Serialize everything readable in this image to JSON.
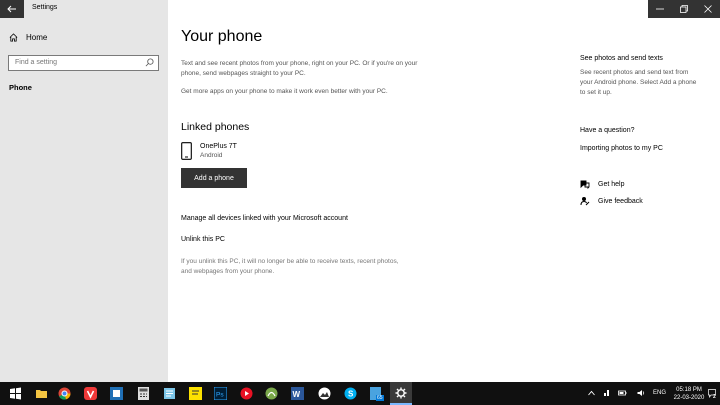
{
  "app": {
    "title": "Settings"
  },
  "nav": {
    "home_label": "Home",
    "search_placeholder": "Find a setting",
    "current_label": "Phone"
  },
  "main": {
    "title": "Your phone",
    "description": "Text and see recent photos from your phone, right on your PC. Or if you're on your phone, send webpages straight to your PC.",
    "more_apps": "Get more apps on your phone to make it work even better with your PC.",
    "linked_title": "Linked phones",
    "device": {
      "name": "OnePlus 7T",
      "os": "Android"
    },
    "add_button": "Add a phone",
    "manage_link": "Manage all devices linked with your Microsoft account",
    "unlink_link": "Unlink this PC",
    "unlink_desc": "If you unlink this PC, it will no longer be able to receive texts, recent photos, and webpages from your phone."
  },
  "side": {
    "photos_title": "See photos and send texts",
    "photos_desc": "See recent photos and send text from your Android phone. Select Add a phone to set it up.",
    "question_title": "Have a question?",
    "importing_link": "Importing photos to my PC",
    "help_label": "Get help",
    "feedback_label": "Give feedback"
  },
  "taskbar": {
    "badge": "65",
    "lang": "ENG",
    "time": "05:18 PM",
    "date": "22-03-2020",
    "notif_count": "2"
  }
}
